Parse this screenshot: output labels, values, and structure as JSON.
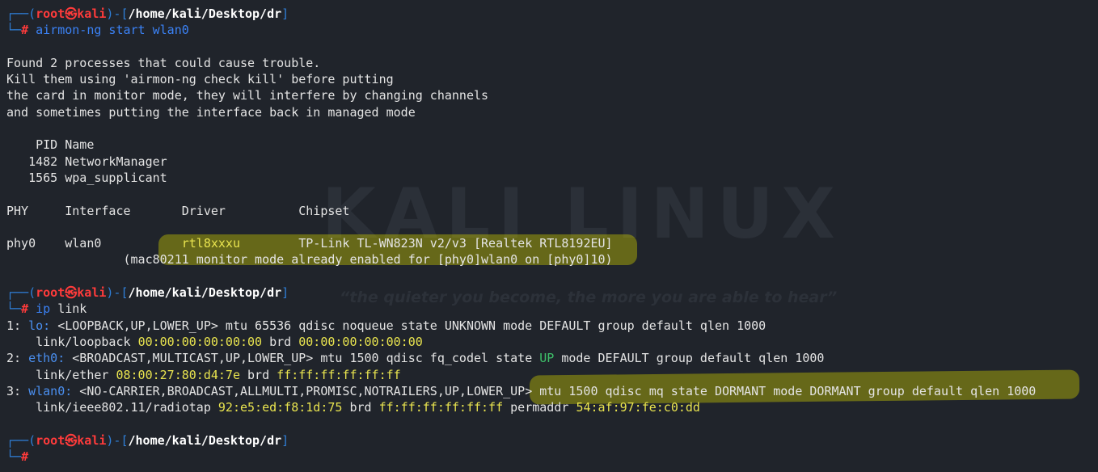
{
  "watermark": {
    "logo": "KALI LINUX",
    "tagline": "“the quieter you become, the more you are able to hear”"
  },
  "prompt": {
    "user": "root",
    "at": "㉿",
    "host": "kali",
    "path": "/home/kali/Desktop/dr",
    "symbol": "#"
  },
  "commands": {
    "first": "airmon-ng start wlan0",
    "second_cmd": "ip",
    "second_arg": "link"
  },
  "airmon": {
    "warning": [
      "Found 2 processes that could cause trouble.",
      "Kill them using 'airmon-ng check kill' before putting",
      "the card in monitor mode, they will interfere by changing channels",
      "and sometimes putting the interface back in managed mode"
    ],
    "proc_header": "    PID Name",
    "procs": [
      "   1482 NetworkManager",
      "   1565 wpa_supplicant"
    ],
    "table_header": "PHY     Interface       Driver          Chipset",
    "row_a": "phy0    wlan0           ",
    "row_driver": "rtl8xxxu",
    "row_b": "        TP-Link TL-WN823N v2/v3 [Realtek RTL8192EU]",
    "monitor_note": "                (mac80211 monitor mode already enabled for [phy0]wlan0 on [phy0]10)"
  },
  "iplink": {
    "lo_num": "1: ",
    "lo_name": "lo:",
    "lo_rest": " <LOOPBACK,UP,LOWER_UP> mtu 65536 qdisc noqueue state UNKNOWN mode DEFAULT group default qlen 1000",
    "lo_link": "    link/loopback ",
    "lo_mac": "00:00:00:00:00:00",
    "brd": " brd ",
    "lo_brd": "00:00:00:00:00:00",
    "eth_num": "2: ",
    "eth_name": "eth0:",
    "eth_a": " <BROADCAST,MULTICAST,UP,LOWER_UP> mtu 1500 qdisc fq_codel state ",
    "eth_state": "UP",
    "eth_b": " mode DEFAULT group default qlen 1000",
    "eth_link": "    link/ether ",
    "eth_mac": "08:00:27:80:d4:7e",
    "eth_brd": "ff:ff:ff:ff:ff:ff",
    "wlan_num": "3: ",
    "wlan_name": "wlan0:",
    "wlan_rest": " <NO-CARRIER,BROADCAST,ALLMULTI,PROMISC,NOTRAILERS,UP,LOWER_UP> mtu 1500 qdisc mq state DORMANT mode DORMANT group default qlen 1000",
    "wlan_link": "    link/ieee802.11/radiotap ",
    "wlan_mac": "92:e5:ed:f8:1d:75",
    "wlan_brd": "ff:ff:ff:ff:ff:ff",
    "permaddr": " permaddr ",
    "wlan_perm": "54:af:97:fe:c0:dd"
  },
  "colors": {
    "background": "#20242b",
    "prompt_red": "#ff3b3b",
    "frame_blue": "#2f7fd8",
    "highlight": "#c8c800"
  }
}
